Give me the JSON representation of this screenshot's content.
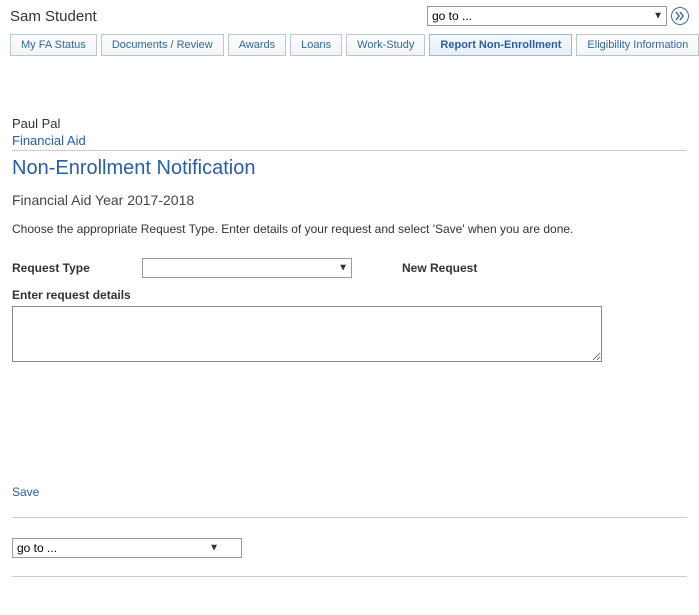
{
  "header": {
    "top_name": "Sam Student",
    "goto_selected": "go to ..."
  },
  "tabs": [
    {
      "label": "My FA Status"
    },
    {
      "label": "Documents / Review"
    },
    {
      "label": "Awards"
    },
    {
      "label": "Loans"
    },
    {
      "label": "Work-Study"
    },
    {
      "label": "Report Non-Enrollment"
    },
    {
      "label": "Eligibility Information"
    }
  ],
  "content": {
    "user_name": "Paul Pal",
    "breadcrumb": "Financial Aid",
    "page_title": "Non-Enrollment Notification",
    "subheading": "Financial Aid Year 2017-2018",
    "instructions": "Choose the appropriate Request Type.  Enter details of your request and select 'Save' when you are done."
  },
  "form": {
    "request_type_label": "Request Type",
    "request_type_value": "",
    "status_text": "New Request",
    "details_label": "Enter request details",
    "details_value": ""
  },
  "actions": {
    "save_label": "Save"
  },
  "footer": {
    "goto_selected": "go to ..."
  }
}
